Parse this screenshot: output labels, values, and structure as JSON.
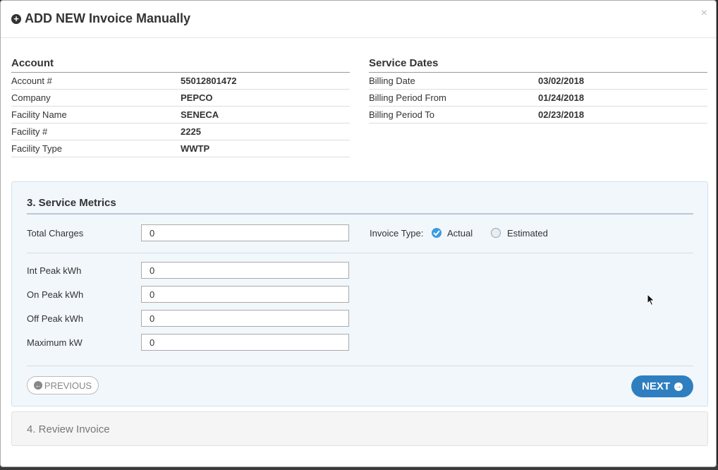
{
  "modal": {
    "title": "ADD NEW Invoice Manually",
    "plus_icon": "circle-plus-icon",
    "close_label": "×"
  },
  "account": {
    "title": "Account",
    "rows": [
      {
        "label": "Account #",
        "value": "55012801472"
      },
      {
        "label": "Company",
        "value": "PEPCO"
      },
      {
        "label": "Facility Name",
        "value": "SENECA"
      },
      {
        "label": "Facility #",
        "value": "2225"
      },
      {
        "label": "Facility Type",
        "value": "WWTP"
      }
    ]
  },
  "service_dates": {
    "title": "Service Dates",
    "rows": [
      {
        "label": "Billing Date",
        "value": "03/02/2018"
      },
      {
        "label": "Billing Period From",
        "value": "01/24/2018"
      },
      {
        "label": "Billing Period To",
        "value": "02/23/2018"
      }
    ]
  },
  "metrics": {
    "title": "3. Service Metrics",
    "total_charges": {
      "label": "Total Charges",
      "value": "0"
    },
    "invoice_type": {
      "label": "Invoice Type:",
      "options": [
        {
          "label": "Actual",
          "checked": true
        },
        {
          "label": "Estimated",
          "checked": false
        }
      ]
    },
    "fields": [
      {
        "label": "Int Peak kWh",
        "value": "0"
      },
      {
        "label": "On Peak kWh",
        "value": "0"
      },
      {
        "label": "Off Peak kWh",
        "value": "0"
      },
      {
        "label": "Maximum kW",
        "value": "0"
      }
    ],
    "previous_label": "PREVIOUS",
    "next_label": "NEXT"
  },
  "review": {
    "title": "4. Review Invoice"
  },
  "colors": {
    "primary": "#2f7fc0",
    "radio_checked": "#3a9ce0",
    "panel_bg": "#f2f7fc"
  }
}
